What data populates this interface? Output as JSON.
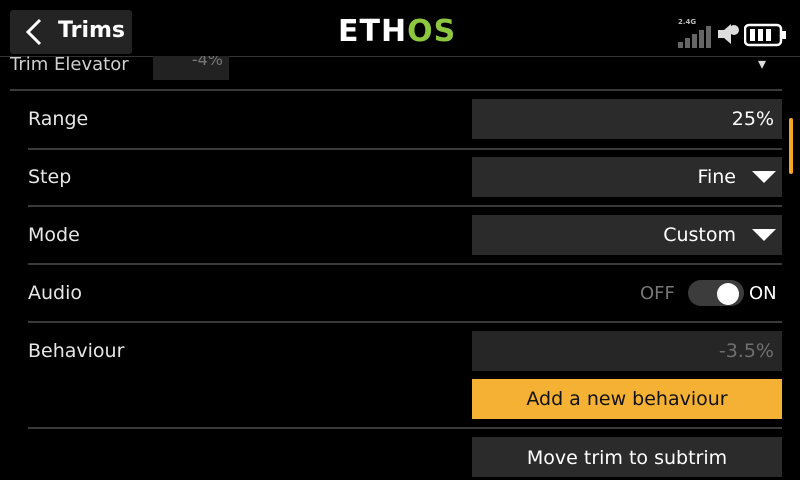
{
  "header": {
    "title": "Trims",
    "logo_part1": "ETH",
    "logo_part2": "OS",
    "rf_band": "2.4G",
    "icons": [
      "chevron-left-icon",
      "signal-bars-icon",
      "volume-icon",
      "battery-icon"
    ]
  },
  "partial_row": {
    "label": "Trim Elevator",
    "value": "-4%"
  },
  "rows": {
    "range": {
      "label": "Range",
      "value": "25%"
    },
    "step": {
      "label": "Step",
      "value": "Fine"
    },
    "mode": {
      "label": "Mode",
      "value": "Custom"
    },
    "audio": {
      "label": "Audio",
      "off_label": "OFF",
      "on_label": "ON",
      "state": "on"
    },
    "behaviour": {
      "label": "Behaviour",
      "value": "-3.5%"
    }
  },
  "buttons": {
    "add_behaviour": "Add a new behaviour",
    "move_trim": "Move trim to subtrim"
  },
  "colors": {
    "background": "#000000",
    "field": "#2b2b2b",
    "accent": "#f5b134",
    "logo_green": "#8dc63f",
    "scrollbar": "#f5a623"
  }
}
